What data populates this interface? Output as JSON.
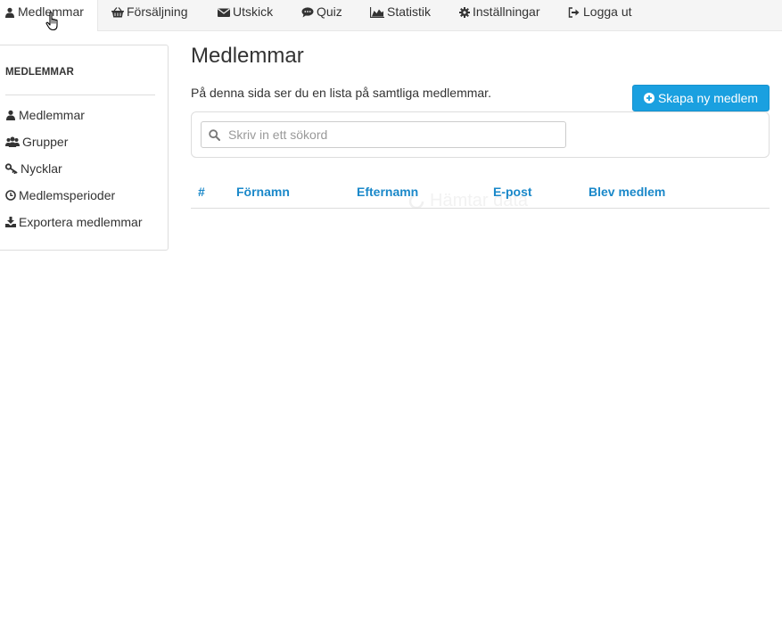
{
  "nav": {
    "items": [
      {
        "label": "Medlemmar",
        "icon": "user-icon"
      },
      {
        "label": "Försäljning",
        "icon": "basket-icon"
      },
      {
        "label": "Utskick",
        "icon": "envelope-icon"
      },
      {
        "label": "Quiz",
        "icon": "comment-icon"
      },
      {
        "label": "Statistik",
        "icon": "area-chart-icon"
      },
      {
        "label": "Inställningar",
        "icon": "gear-icon"
      },
      {
        "label": "Logga ut",
        "icon": "sign-out-icon"
      }
    ],
    "active": "Medlemmar"
  },
  "sidebar": {
    "heading": "MEDLEMMAR",
    "items": [
      {
        "label": "Medlemmar",
        "icon": "user-icon"
      },
      {
        "label": "Grupper",
        "icon": "users-icon"
      },
      {
        "label": "Nycklar",
        "icon": "key-icon"
      },
      {
        "label": "Medlemsperioder",
        "icon": "clock-icon"
      },
      {
        "label": "Exportera medlemmar",
        "icon": "download-icon"
      }
    ]
  },
  "main": {
    "title": "Medlemmar",
    "intro": "På denna sida ser du en lista på samtliga medlemmar.",
    "create_button": "Skapa ny medlem",
    "search_placeholder": "Skriv in ett sökord",
    "search_value": "",
    "table": {
      "columns": [
        "#",
        "Förnamn",
        "Efternamn",
        "E-post",
        "Blev medlem"
      ]
    },
    "loading_text": "Hämtar data"
  },
  "colors": {
    "accent": "#1aa0e0",
    "link": "#1a88c9",
    "nav_bg": "#f5f5f5"
  }
}
